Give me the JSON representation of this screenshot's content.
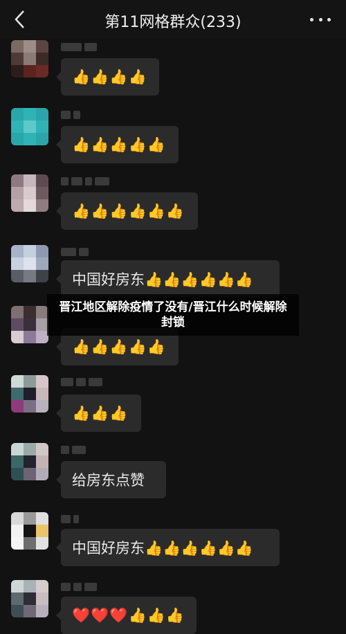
{
  "header": {
    "title": "第11网格群众(233)",
    "back_icon": "chevron-left-icon",
    "more_icon": "more-dots-icon"
  },
  "messages": [
    {
      "text": "👍👍👍👍"
    },
    {
      "text": "👍👍👍👍👍"
    },
    {
      "text": "👍👍👍👍👍👍"
    },
    {
      "text": "中国好房东👍👍👍👍👍👍"
    },
    {
      "text": "👍👍👍👍👍"
    },
    {
      "text": "👍👍👍"
    },
    {
      "text": "给房东点赞"
    },
    {
      "text": "中国好房东👍👍👍👍👍👍"
    },
    {
      "text": "❤️❤️❤️👍👍👍"
    }
  ],
  "overlay": {
    "headline": "晋江地区解除疫情了没有/晋江什么时候解除封锁"
  },
  "colors": {
    "background": "#121212",
    "bubble": "#2b2b2b",
    "text": "#eaeaea"
  }
}
